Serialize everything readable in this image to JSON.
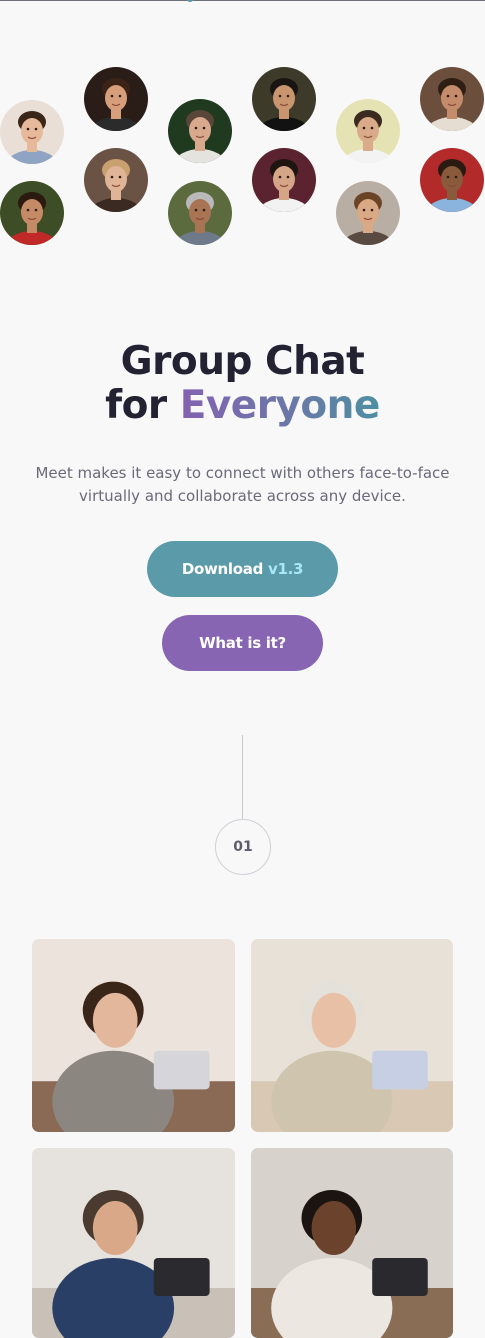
{
  "hero": {
    "title_line1": "Group Chat",
    "title_for": "for",
    "title_highlight": "Everyone",
    "subtitle": "Meet makes it easy to connect with others face-to-face virtually and collaborate across any device."
  },
  "buttons": {
    "download_label": "Download",
    "download_version": "v1.3",
    "what_label": "What is it?"
  },
  "step": {
    "number": "01"
  },
  "avatars": [
    {
      "name": "avatar-1",
      "bg": "#e9dfd6",
      "skin": "#e6b99a",
      "hair": "#3a2618",
      "shirt": "#8fa3c3"
    },
    {
      "name": "avatar-2",
      "bg": "#2a1d17",
      "skin": "#d79e7c",
      "hair": "#3b2416",
      "shirt": "#2b2b2b"
    },
    {
      "name": "avatar-3",
      "bg": "#1f3a1f",
      "skin": "#d8a98c",
      "hair": "#5a4638",
      "shirt": "#e5e3de"
    },
    {
      "name": "avatar-4",
      "bg": "#3d3a2a",
      "skin": "#c9956f",
      "hair": "#181512",
      "shirt": "#121212"
    },
    {
      "name": "avatar-5",
      "bg": "#e5e3b3",
      "skin": "#d9ab8a",
      "hair": "#3a2a1f",
      "shirt": "#f3f3f3"
    },
    {
      "name": "avatar-6",
      "bg": "#6b4e3c",
      "skin": "#c48c6a",
      "hair": "#2e1e14",
      "shirt": "#e6ddd2"
    },
    {
      "name": "avatar-7",
      "bg": "#3d4d25",
      "skin": "#c58b66",
      "hair": "#2a1a10",
      "shirt": "#c12828"
    },
    {
      "name": "avatar-8",
      "bg": "#6a5344",
      "skin": "#e0b497",
      "hair": "#c9a070",
      "shirt": "#3b2a22"
    },
    {
      "name": "avatar-9",
      "bg": "#5c6b3e",
      "skin": "#a87454",
      "hair": "#b9b9b9",
      "shirt": "#6e7a8a"
    },
    {
      "name": "avatar-10",
      "bg": "#5b2230",
      "skin": "#d6a486",
      "hair": "#1e1511",
      "shirt": "#f2f2f2"
    },
    {
      "name": "avatar-11",
      "bg": "#b8aea3",
      "skin": "#d9a985",
      "hair": "#6b4428",
      "shirt": "#5a4b42"
    },
    {
      "name": "avatar-12",
      "bg": "#b32a2a",
      "skin": "#8a5a3c",
      "hair": "#2a1a12",
      "shirt": "#8ab4dd"
    }
  ],
  "photos": [
    {
      "name": "photo-woman-laptop",
      "wall": "#ece3dc",
      "table": "#8a6a55",
      "shirt": "#8c8680",
      "skin": "#e2b79b",
      "hair": "#3a2519",
      "device": "#d6d6da"
    },
    {
      "name": "photo-three-women-phone",
      "wall": "#e8e1d8",
      "table": "#d9c9b4",
      "shirt": "#cfc4ae",
      "skin": "#e8c0a5",
      "hair": "#e4e0da",
      "device": "#c7cfe5"
    },
    {
      "name": "photo-video-call-laptop",
      "wall": "#e6e3df",
      "table": "#c9c1b8",
      "shirt": "#2a3f66",
      "skin": "#d9a888",
      "hair": "#4a3a30",
      "device": "#2b2b2f"
    },
    {
      "name": "photo-man-smartphone",
      "wall": "#d8d2cc",
      "table": "#8a6d55",
      "shirt": "#ece7e1",
      "skin": "#6b432c",
      "hair": "#1b1410",
      "device": "#2a2a2e"
    }
  ]
}
